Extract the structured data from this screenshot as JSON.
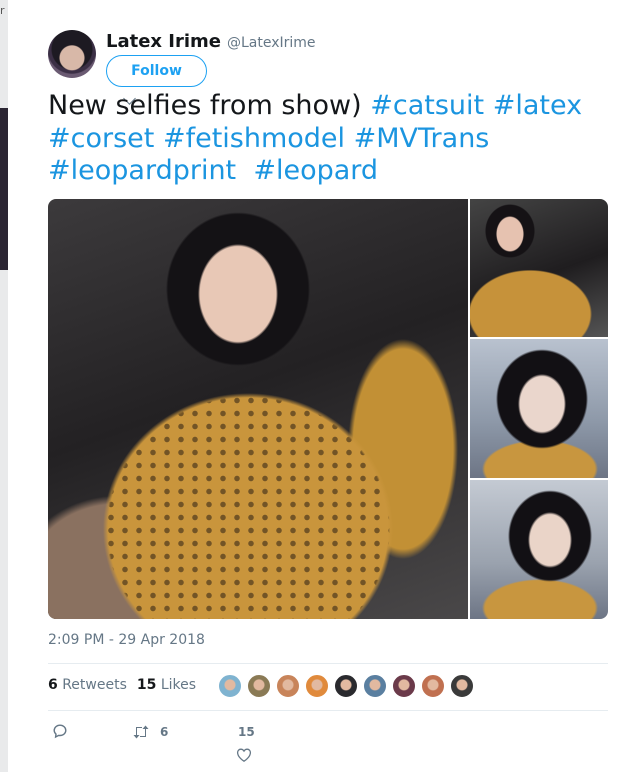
{
  "tweet": {
    "author_name": "Latex Irime",
    "author_handle": "@LatexIrime",
    "follow_label": "Follow",
    "text_plain": "New selfies from show) ",
    "hashtags": [
      "#catsuit",
      "#latex",
      "#corset",
      "#fetishmodel",
      "#MVTrans",
      "#leopardprint",
      "#leopard"
    ],
    "timestamp": "2:09 PM - 29 Apr 2018",
    "retweets_count": "6",
    "retweets_label": "Retweets",
    "likes_count": "15",
    "likes_label": "Likes"
  },
  "actions": {
    "retweet_count": "6",
    "like_count": "15"
  },
  "likers": [
    {
      "color": "#7fb3d0"
    },
    {
      "color": "#8a7a55"
    },
    {
      "color": "#c8845a"
    },
    {
      "color": "#e08a3c"
    },
    {
      "color": "#2a2a2e"
    },
    {
      "color": "#5a7fa0"
    },
    {
      "color": "#6b3a4a"
    },
    {
      "color": "#c07050"
    },
    {
      "color": "#3a3a3a"
    }
  ],
  "colors": {
    "accent": "#1da1f2",
    "hashtag": "#1b95e0",
    "text": "#14171a",
    "muted": "#657786"
  },
  "icons": [
    "reply-icon",
    "retweet-icon",
    "heart-icon",
    "chevron-down-icon"
  ]
}
